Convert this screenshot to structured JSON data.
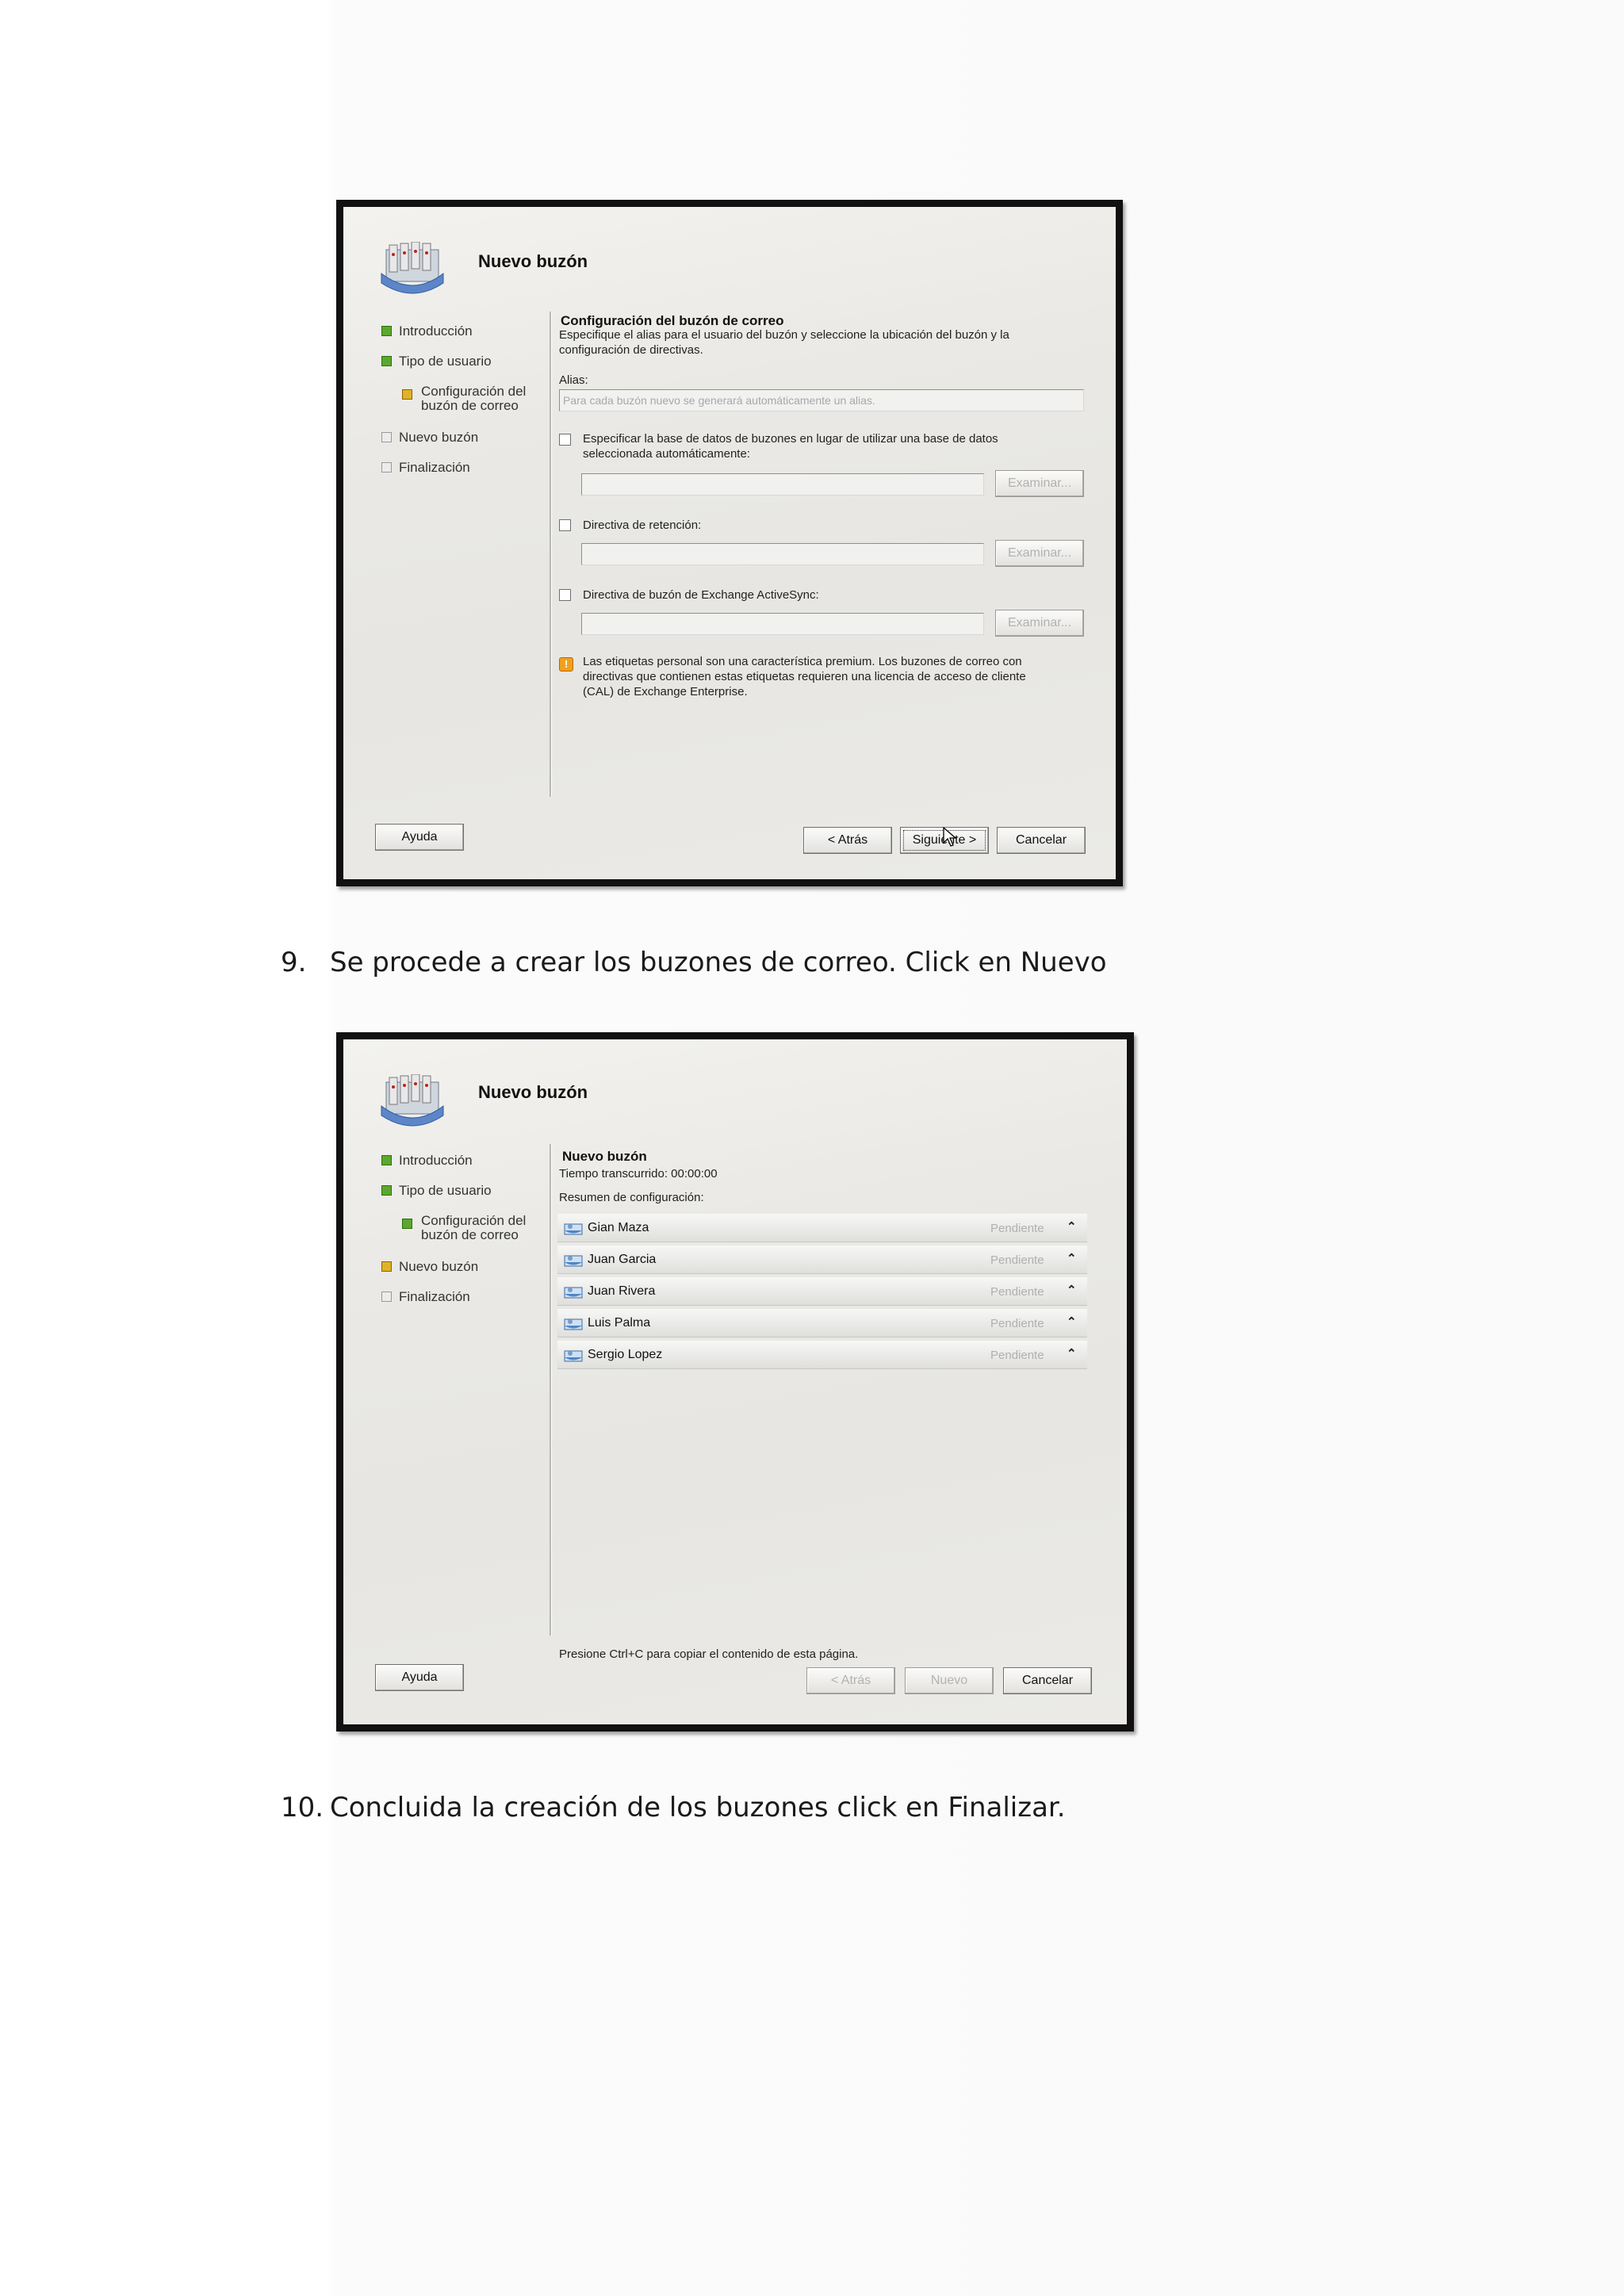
{
  "dialog1": {
    "title": "Nuevo buzón",
    "nav": [
      {
        "label": "Introducción",
        "state": "done"
      },
      {
        "label": "Tipo de usuario",
        "state": "done"
      },
      {
        "label": "Configuración del buzón de correo",
        "line1": "Configuración del",
        "line2": "buzón de correo",
        "state": "current"
      },
      {
        "label": "Nuevo buzón",
        "state": "todo"
      },
      {
        "label": "Finalización",
        "state": "todo"
      }
    ],
    "section_title": "Configuración del buzón de correo",
    "section_desc_line1": "Especifique el alias para el usuario del buzón y seleccione la ubicación del buzón y la",
    "section_desc_line2": "configuración de directivas.",
    "alias_label": "Alias:",
    "alias_placeholder": "Para cada buzón nuevo se generará automáticamente un alias.",
    "db_checkbox_line1": "Especificar la base de datos de buzones en lugar de utilizar una base de datos",
    "db_checkbox_line2": "seleccionada automáticamente:",
    "retention_checkbox": "Directiva de retención:",
    "activesync_checkbox": "Directiva de buzón de Exchange ActiveSync:",
    "browse_label": "Examinar...",
    "note_line1": "Las etiquetas personal son una característica premium. Los buzones de correo con",
    "note_line2": "directivas que contienen estas etiquetas requieren una licencia de acceso de cliente",
    "note_line3": "(CAL) de Exchange Enterprise.",
    "help_button": "Ayuda",
    "back_button": "< Atrás",
    "next_button": "Siguiente >",
    "cancel_button": "Cancelar"
  },
  "step9": {
    "number": "9.",
    "text": "Se procede a crear los buzones de correo. Click en Nuevo"
  },
  "dialog2": {
    "title": "Nuevo buzón",
    "nav": [
      {
        "label": "Introducción",
        "state": "done"
      },
      {
        "label": "Tipo de usuario",
        "state": "done"
      },
      {
        "line1": "Configuración del",
        "line2": "buzón de correo",
        "state": "done"
      },
      {
        "label": "Nuevo buzón",
        "state": "current"
      },
      {
        "label": "Finalización",
        "state": "todo"
      }
    ],
    "section_title": "Nuevo buzón",
    "elapsed": "Tiempo transcurrido: 00:00:00",
    "summary_label": "Resumen de configuración:",
    "mailboxes": [
      {
        "name": "Gian Maza",
        "status": "Pendiente"
      },
      {
        "name": "Juan Garcia",
        "status": "Pendiente"
      },
      {
        "name": "Juan Rivera",
        "status": "Pendiente"
      },
      {
        "name": "Luis Palma",
        "status": "Pendiente"
      },
      {
        "name": "Sergio Lopez",
        "status": "Pendiente"
      }
    ],
    "copy_hint": "Presione Ctrl+C para copiar el contenido de esta página.",
    "help_button": "Ayuda",
    "back_button": "< Atrás",
    "new_button": "Nuevo",
    "cancel_button": "Cancelar"
  },
  "step10": {
    "number": "10.",
    "text": "Concluida la creación de los buzones click en Finalizar."
  },
  "icons": {
    "wizard": "mailbox-wizard-icon",
    "row": "mailbox-user-icon",
    "expand": "double-chevron-up-icon",
    "warning": "warning-icon"
  }
}
